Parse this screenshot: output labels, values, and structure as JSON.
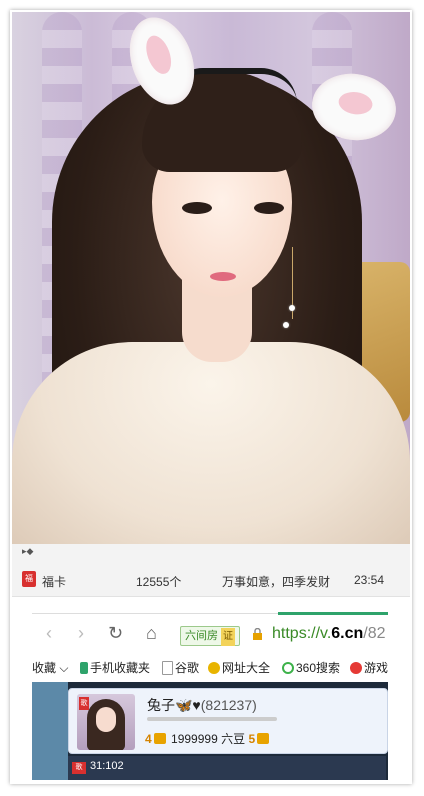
{
  "chat": {
    "top_fragment": "▸◆",
    "icon_label": "福",
    "name": "福卡",
    "count": "12555个",
    "message": "万事如意，四季发财",
    "time": "23:54"
  },
  "browser": {
    "back_icon": "‹",
    "forward_icon": "›",
    "refresh_icon": "↻",
    "home_icon": "⌂",
    "site_tag": "六间房",
    "site_tag_badge": "证",
    "url_scheme": "https://v.",
    "url_domain": "6.cn",
    "url_rest": "/82",
    "bookmarks": [
      {
        "label": "收藏 ⌵",
        "icon": "star-icon",
        "color": ""
      },
      {
        "label": "手机收藏夹",
        "icon": "phone-icon",
        "color": "#2ea36b"
      },
      {
        "label": "谷歌",
        "icon": "file-icon",
        "color": "#999999"
      },
      {
        "label": "网址大全",
        "icon": "plus-circle-icon",
        "color": "#e8b400"
      },
      {
        "label": "360搜索",
        "icon": "360-icon",
        "color": "#3db24a"
      },
      {
        "label": "游戏",
        "icon": "game-icon",
        "color": "#e53935"
      }
    ]
  },
  "profile": {
    "avatar_badge": "歌",
    "name": "兔子",
    "name_decor": "🦋♥",
    "id": "(821237)",
    "level_left": "4",
    "beans": "1999999 六豆",
    "level_right": "5"
  },
  "message_row": {
    "badge": "歌",
    "text": "31:102"
  },
  "colors": {
    "accent_green": "#2ea36b",
    "page_bg": "#1d2a3a"
  }
}
